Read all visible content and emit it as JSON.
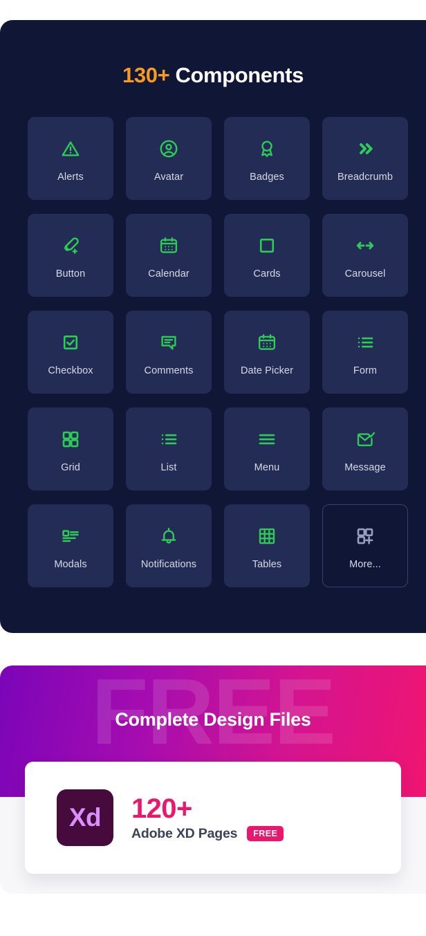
{
  "components_section": {
    "title_accent": "130+",
    "title_rest": " Components",
    "accent_color": "#f79a20",
    "panel_bg": "#101736",
    "tile_bg": "#232c55",
    "icon_color": "#2ecc57",
    "label_color": "#d6d9e4",
    "tiles": [
      {
        "label": "Alerts",
        "icon": "alert-triangle-icon"
      },
      {
        "label": "Avatar",
        "icon": "user-circle-icon"
      },
      {
        "label": "Badges",
        "icon": "award-ribbon-icon"
      },
      {
        "label": "Breadcrumb",
        "icon": "double-chevron-right-icon"
      },
      {
        "label": "Button",
        "icon": "link-plus-icon"
      },
      {
        "label": "Calendar",
        "icon": "calendar-icon"
      },
      {
        "label": "Cards",
        "icon": "square-outline-icon"
      },
      {
        "label": "Carousel",
        "icon": "left-right-arrows-icon"
      },
      {
        "label": "Checkbox",
        "icon": "checkbox-check-icon"
      },
      {
        "label": "Comments",
        "icon": "speech-bubble-icon"
      },
      {
        "label": "Date Picker",
        "icon": "calendar-dots-icon"
      },
      {
        "label": "Form",
        "icon": "bulleted-list-icon"
      },
      {
        "label": "Grid",
        "icon": "four-squares-icon"
      },
      {
        "label": "List",
        "icon": "bulleted-list-icon"
      },
      {
        "label": "Menu",
        "icon": "hamburger-menu-icon"
      },
      {
        "label": "Message",
        "icon": "envelope-check-icon"
      },
      {
        "label": "Modals",
        "icon": "modal-layout-icon"
      },
      {
        "label": "Notifications",
        "icon": "bell-icon"
      },
      {
        "label": "Tables",
        "icon": "table-grid-icon"
      },
      {
        "label": "More...",
        "icon": "squares-plus-icon"
      }
    ]
  },
  "design_section": {
    "watermark": "FREE",
    "title": "Complete Design Files",
    "gradient_from": "#7b05b8",
    "gradient_to": "#f2156e",
    "card": {
      "logo_text": "Xd",
      "logo_bg": "#470a3d",
      "logo_fg": "#da8ffb",
      "count": "120+",
      "count_color": "#e9186d",
      "subtitle": "Adobe XD Pages",
      "badge": "FREE",
      "badge_bg": "#e9186d"
    }
  }
}
